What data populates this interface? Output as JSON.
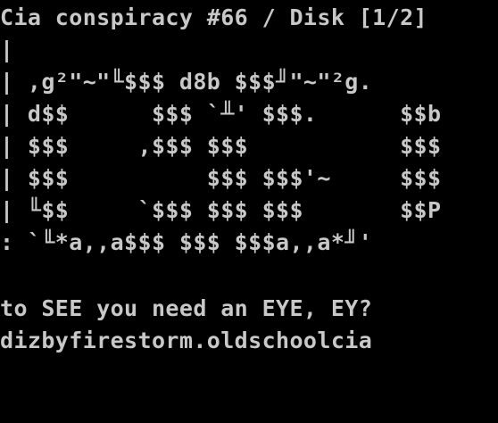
{
  "colors": {
    "background": "#000000",
    "text": "#c8c8c8"
  },
  "title": "Cia conspiracy #66 / Disk [1/2]",
  "art_lines": [
    "|                                       |",
    "| ,g²\"~\"╙$$$ d8b $$$╜\"~\"²g.            |",
    "| d$$      $$$ `╨' $$$.      $$b       |",
    "| $$$     ,$$$ $$$           $$$       |",
    "| $$$          $$$ $$$'~     $$$       |",
    "| ╙$$     `$$$ $$$ $$$       $$P       |",
    ": `╙*a,,a$$$ $$$ $$$a,,a*╜'           :",
    "                                       ."
  ],
  "tagline": "to SEE you need an EYE, EY?",
  "credit": "dizbyfirestorm.oldschoolcia"
}
